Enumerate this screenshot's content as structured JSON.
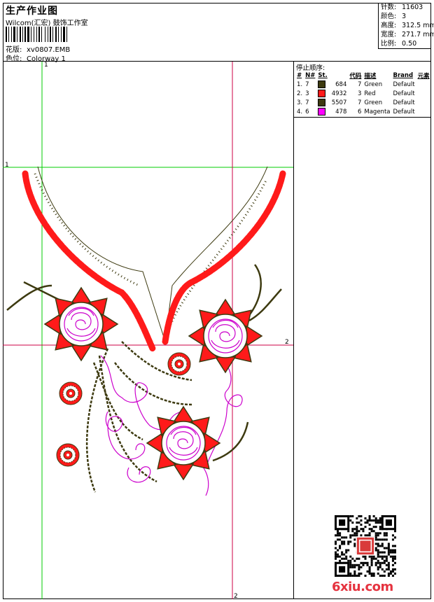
{
  "header": {
    "title": "生产作业图",
    "company": "Wilcom(汇宏) 鼓饰工作室",
    "design_label": "花版:",
    "design_value": "xv0807.EMB",
    "colorway_label": "色位:",
    "colorway_value": "Colorway 1"
  },
  "stats": {
    "stitches_label": "针数:",
    "stitches_value": "11603",
    "colors_label": "颜色:",
    "colors_value": "3",
    "height_label": "高度:",
    "height_value": "312.5 mm",
    "width_label": "宽度:",
    "width_value": "271.7 mm",
    "scale_label": "比例:",
    "scale_value": "0.50"
  },
  "stop_sequence": {
    "title": "停止顺序:",
    "columns": [
      "#",
      "N#",
      "St.",
      "代码",
      "描述",
      "Brand",
      "元素"
    ],
    "rows": [
      {
        "index": "1.",
        "needle": "7",
        "stitches": "684",
        "code": "7",
        "description": "Green",
        "brand": "Default",
        "color": "#3d3a10"
      },
      {
        "index": "2.",
        "needle": "3",
        "stitches": "4932",
        "code": "3",
        "description": "Red",
        "brand": "Default",
        "color": "#ff1a1a"
      },
      {
        "index": "3.",
        "needle": "7",
        "stitches": "5507",
        "code": "7",
        "description": "Green",
        "brand": "Default",
        "color": "#3d3a10"
      },
      {
        "index": "4.",
        "needle": "6",
        "stitches": "478",
        "code": "6",
        "description": "Magenta",
        "brand": "Default",
        "color": "#ff00ff"
      }
    ]
  },
  "guides": {
    "v1_label": "1",
    "h1_label": "1",
    "h2_label": "2",
    "v2_label": "2"
  },
  "colors": {
    "guide_green": "#00cc00",
    "guide_red": "#cc0044",
    "thread_red": "#ff1a1a",
    "thread_green": "#3d3a10",
    "thread_magenta": "#cc00cc"
  },
  "watermark": "6xiu.com",
  "qr_badge": "吉祥",
  "icons": [
    "qr-code-icon"
  ]
}
